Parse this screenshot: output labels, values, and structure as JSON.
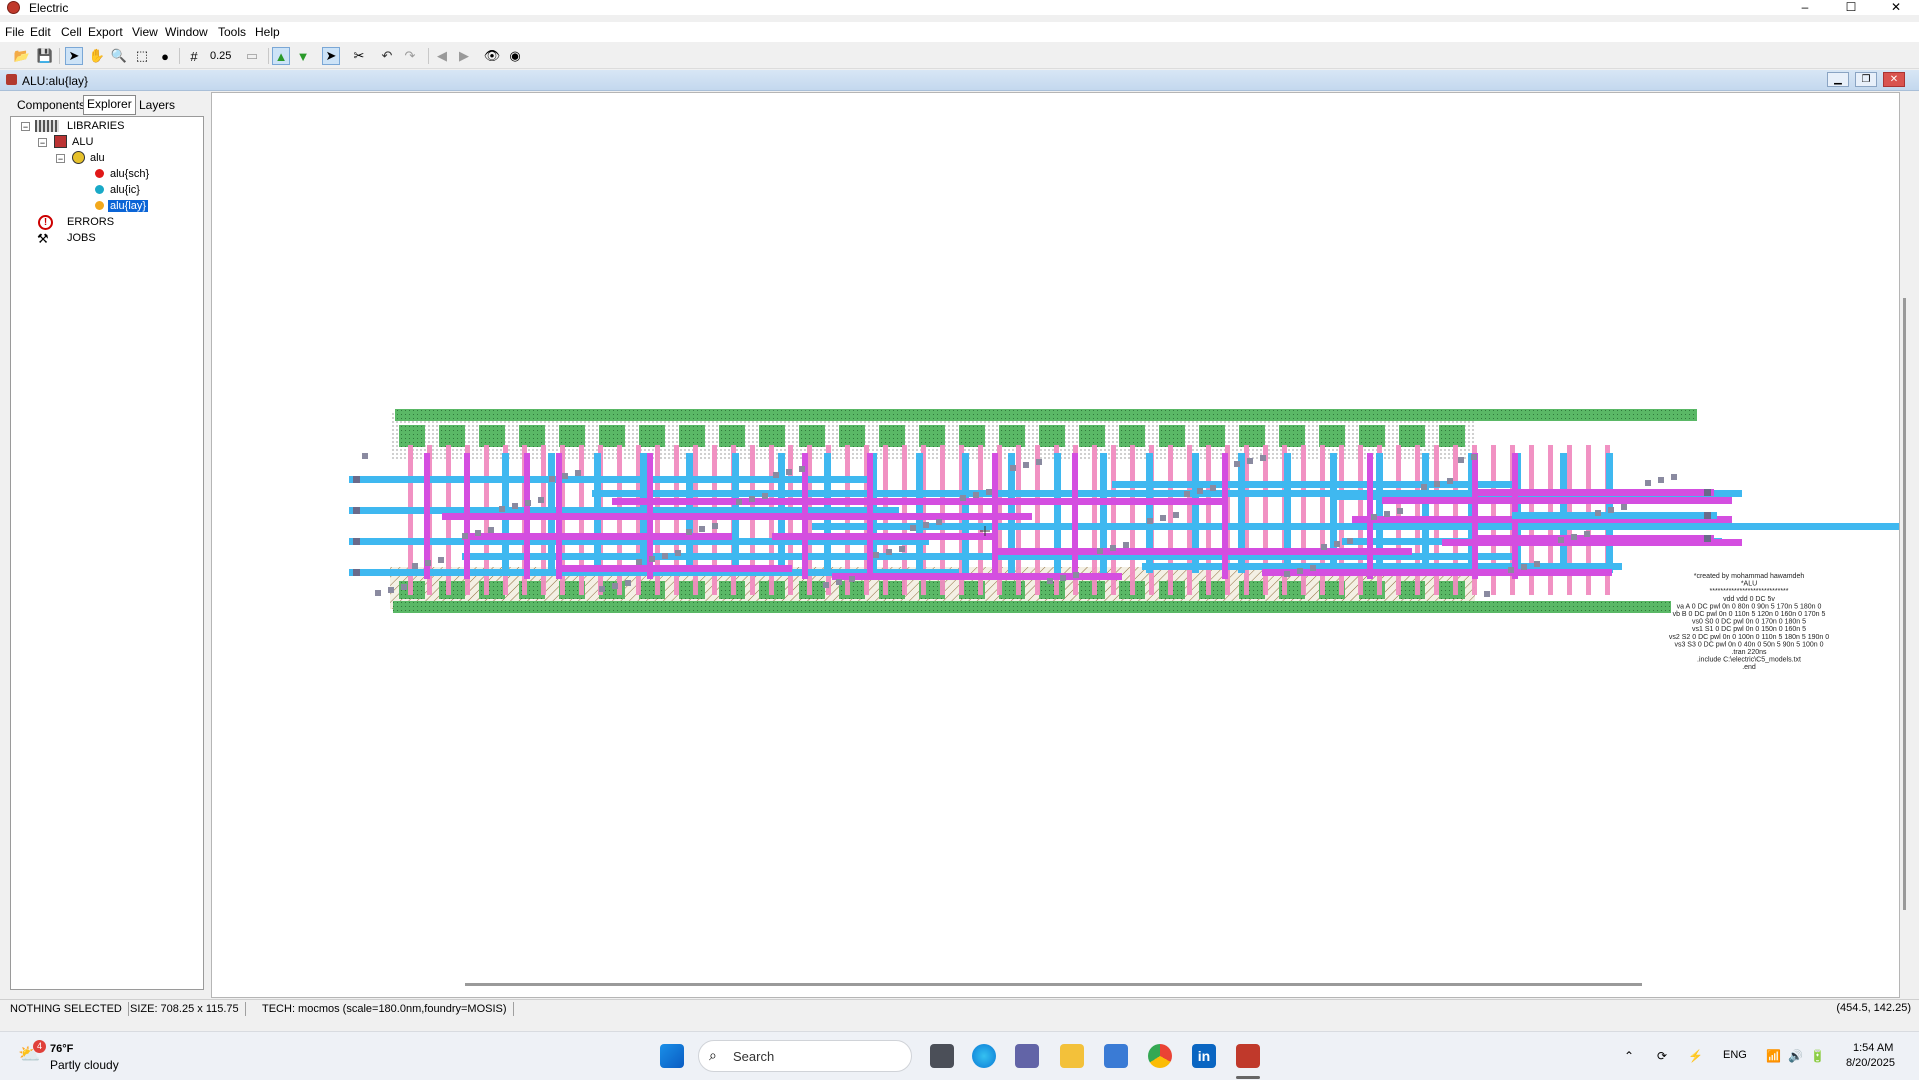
{
  "window": {
    "title": "Electric",
    "minimize": "–",
    "maximize": "☐",
    "close": "✕"
  },
  "menu": [
    "File",
    "Edit",
    "Cell",
    "Export",
    "View",
    "Window",
    "Tools",
    "Help"
  ],
  "toolbar": {
    "grid_scale": "0.25"
  },
  "inner_window": {
    "title": "ALU:alu{lay}"
  },
  "explorer": {
    "tabs": [
      "Components",
      "Explorer",
      "Layers"
    ],
    "selected_tab": "Explorer",
    "tree": {
      "libraries": "LIBRARIES",
      "alu_lib": "ALU",
      "alu_cell": "alu",
      "views": [
        "alu{sch}",
        "alu{ic}",
        "alu{lay}"
      ],
      "errors": "ERRORS",
      "jobs": "JOBS"
    }
  },
  "layout_text": [
    "*created by mohammad hawamdeh",
    "*ALU",
    "*****************************",
    "vdd vdd 0 DC 5v",
    "va A 0 DC pwl 0n 0 80n 0 90n 5 170n 5 180n 0",
    "vb B 0 DC pwl 0n 0 110n 5 120n 0 160n 0 170n 5",
    "vs0 S0 0 DC pwl 0n 0 170n 0 180n 5",
    "vs1 S1 0 DC pwl 0n 0 150n 0 160n 5",
    "vs2 S2 0 DC pwl 0n 0 100n 0 110n 5 180n 5 190n 0",
    "vs3 S3 0 DC pwl 0n 0 40n 0 50n 5 90n 5 100n 0",
    ".tran 220ns",
    ".include C:\\electric\\C5_models.txt",
    ".end"
  ],
  "status": {
    "selection": "NOTHING SELECTED",
    "size": "SIZE: 708.25 x 115.75",
    "tech": "TECH: mocmos (scale=180.0nm,foundry=MOSIS)",
    "coords": "(454.5, 142.25)"
  },
  "taskbar": {
    "weather_temp": "76°F",
    "weather_desc": "Partly cloudy",
    "weather_badge": "4",
    "search_placeholder": "Search",
    "language": "ENG",
    "time": "1:54 AM",
    "date": "8/20/2025"
  },
  "colors": {
    "metal1": "#3fb8f0",
    "metal2": "#d44ee0",
    "poly": "#f08cc0",
    "active": "#5ab866",
    "contact": "#8a8aa0"
  }
}
